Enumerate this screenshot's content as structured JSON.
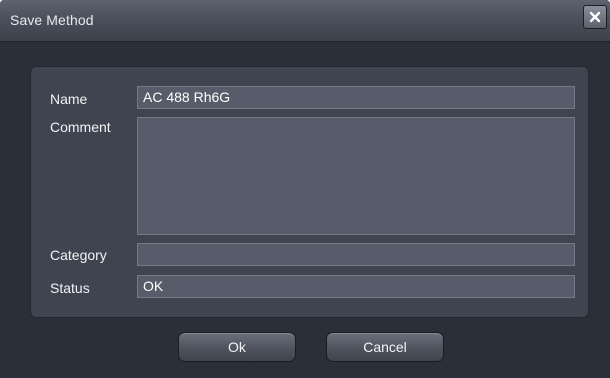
{
  "window": {
    "title": "Save Method",
    "close_icon": "close-icon"
  },
  "form": {
    "name_label": "Name",
    "name_value": "AC 488 Rh6G",
    "comment_label": "Comment",
    "comment_value": "",
    "category_label": "Category",
    "category_value": "",
    "status_label": "Status",
    "status_value": "OK"
  },
  "buttons": {
    "ok_label": "Ok",
    "cancel_label": "Cancel"
  },
  "colors": {
    "window_background": "#2b2f38",
    "panel_background": "#3f4450",
    "field_background": "#575c6a",
    "text": "#f1f2f5"
  }
}
